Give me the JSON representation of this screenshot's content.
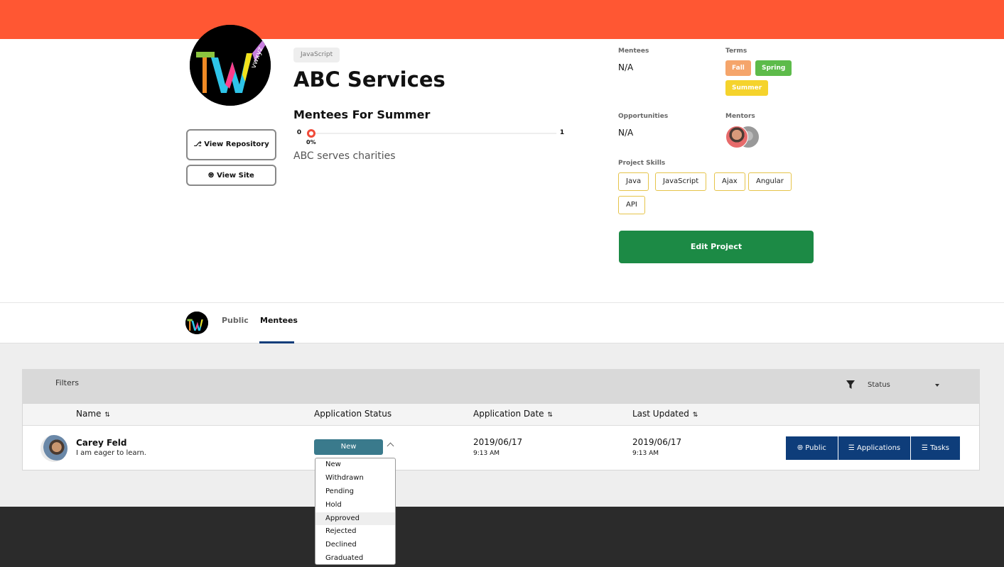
{
  "project": {
    "language_tag": "JavaScript",
    "title": "ABC Services",
    "subtitle": "Mentees For Summer",
    "description": "ABC serves charities",
    "progress": {
      "min": "0",
      "max": "1",
      "percent_label": "0%",
      "fraction": 0
    },
    "buttons": {
      "view_repository": "View Repository",
      "view_site": "View Site",
      "edit_project": "Edit Project"
    }
  },
  "meta": {
    "mentees_label": "Mentees",
    "mentees_value": "N/A",
    "terms_label": "Terms",
    "terms": [
      "Fall",
      "Spring",
      "Summer"
    ],
    "opportunities_label": "Opportunities",
    "opportunities_value": "N/A",
    "mentors_label": "Mentors",
    "skills_label": "Project Skills",
    "skills": [
      "Java",
      "JavaScript",
      "Ajax",
      "Angular",
      "API"
    ]
  },
  "tabs": {
    "public": "Public",
    "mentees": "Mentees",
    "active": "Mentees"
  },
  "filters": {
    "label": "Filters",
    "status_placeholder": "Status"
  },
  "table": {
    "headers": [
      "Name",
      "Application Status",
      "Application Date",
      "Last Updated"
    ],
    "rows": [
      {
        "name": "Carey Feld",
        "bio": "I am eager to learn.",
        "status": "New",
        "app_date": "2019/06/17",
        "app_time": "9:13 AM",
        "updated_date": "2019/06/17",
        "updated_time": "9:13 AM",
        "actions": [
          "Public",
          "Applications",
          "Tasks"
        ]
      }
    ]
  },
  "status_dropdown": {
    "options": [
      "New",
      "Withdrawn",
      "Pending",
      "Hold",
      "Approved",
      "Rejected",
      "Declined",
      "Graduated"
    ],
    "highlighted": "Approved"
  },
  "colors": {
    "topbar": "#ff5733",
    "edit_button": "#1c8a45",
    "action_button": "#0e3d7a",
    "status_button": "#3a7a8c"
  }
}
